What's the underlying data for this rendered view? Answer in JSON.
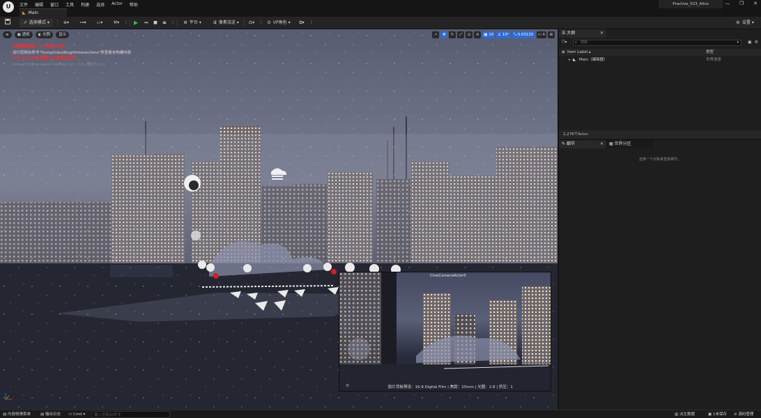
{
  "menubar": {
    "logo": "U",
    "items": [
      "文件",
      "编辑",
      "窗口",
      "工具",
      "构建",
      "选择",
      "Actor",
      "帮助"
    ],
    "project_name": "Practive_023_Alice",
    "window_controls": [
      "—",
      "❐",
      "✕"
    ]
  },
  "tab": {
    "level_label": "Main"
  },
  "toolbar": {
    "mode_label": "选项模式",
    "platform_label": "平台",
    "pixel_streaming_label": "像素流送",
    "vp_role_label": "VP角色",
    "settings_label": "设置"
  },
  "viewport": {
    "buttons": [
      "透视",
      "光照",
      "显示"
    ],
    "messages": [
      {
        "text": "光照需要重建（1 未构建 对象）",
        "style": "red"
      },
      {
        "text": "运行控制台命令\"DumpUnbuiltLightInteractions\"来查看未构建内容",
        "style": "light"
      },
      {
        "text": "474.727 MiB 需要上的纹理流送池",
        "style": "red"
      },
      {
        "text": "Unreal Engine Level Overlap (11 / 11), 超过1(11)",
        "style": "dim"
      }
    ],
    "tools": {
      "grid_value": "10",
      "angle_value": "10°",
      "scale_value": "0.03125",
      "camera_speed": "4"
    }
  },
  "camera_preview": {
    "label": "CineCameraActor0",
    "info": "胶片背板预设：16:9 Digital Film | 焦距：25mm | 光圈：2.8 | 挤压：1",
    "corner": "0"
  },
  "outliner": {
    "tab_label": "大纲",
    "search_placeholder": "搜索",
    "col_label": "Item Label",
    "col_type": "类型",
    "rows": [
      {
        "name": "Main（编辑器）",
        "type": "世界场景"
      }
    ],
    "footer": "2,276个Actor"
  },
  "details": {
    "tab_label": "细节",
    "world_partition_label": "世界分区",
    "empty_message": "选择一个对象来查看细节。"
  },
  "statusbar": {
    "content_drawer": "内容侧滑菜单",
    "output_log": "输出日志",
    "cmd": "Cmd",
    "cmd_placeholder": "输入控制台命令",
    "derived_data": "派生数据",
    "unsaved": "1未保存",
    "source_control": "源码管理"
  },
  "colors": {
    "accent": "#2c6bd6",
    "play": "#3cbc3c",
    "warning": "#ff2a2a"
  }
}
